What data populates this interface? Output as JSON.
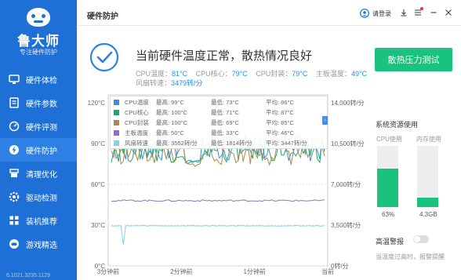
{
  "app": {
    "name": "鲁大师",
    "slogan": "专注硬件防护",
    "version": "6.1021.3235.1129"
  },
  "sidebar": {
    "items": [
      {
        "label": "硬件体检",
        "icon": "monitor-icon"
      },
      {
        "label": "硬件参数",
        "icon": "list-icon"
      },
      {
        "label": "硬件评测",
        "icon": "gauge-icon"
      },
      {
        "label": "硬件防护",
        "icon": "lightning-icon",
        "active": true
      },
      {
        "label": "清理优化",
        "icon": "broom-icon"
      },
      {
        "label": "驱动检测",
        "icon": "gear-icon"
      },
      {
        "label": "装机推荐",
        "icon": "grid-icon"
      },
      {
        "label": "游戏精选",
        "icon": "gamepad-icon"
      }
    ]
  },
  "header": {
    "title": "硬件防护",
    "login_label": "请登录"
  },
  "status": {
    "title": "当前硬件温度正常，散热情况良好",
    "cpu_temp_label": "CPU温度：",
    "cpu_temp_value": "81°C",
    "cpu_core_label": "CPU核心：",
    "cpu_core_value": "79°C",
    "cpu_pkg_label": "CPU封装：",
    "cpu_pkg_value": "79°C",
    "board_label": "主板温度：",
    "board_value": "49°C",
    "fan_label": "风扇转速：",
    "fan_value": "3479转/分"
  },
  "test_button": "散热压力测试",
  "chart_data": {
    "type": "line",
    "x": [
      "3分钟前",
      "2分钟前",
      "1分钟前",
      "当前"
    ],
    "y_left_ticks": [
      "0°C",
      "30°C",
      "60°C",
      "90°C",
      "120°C"
    ],
    "y_right_ticks": [
      "0转/分",
      "3,500转/分",
      "7,000转/分",
      "10,500转/分",
      "14,000转/分"
    ],
    "ylim_left": [
      0,
      120
    ],
    "ylim_right": [
      0,
      14000
    ],
    "series": [
      {
        "name": "CPU温度",
        "color": "#3b8fdc",
        "max": "最高: 99°C",
        "min": "最低: 73°C",
        "avg": "平均: 86°C",
        "level": 86,
        "amp": 9,
        "axis": "left"
      },
      {
        "name": "CPU核心",
        "color": "#1fa866",
        "max": "最高: 100°C",
        "min": "最低: 71°C",
        "avg": "平均: 87°C",
        "level": 86,
        "amp": 10,
        "axis": "left"
      },
      {
        "name": "CPU封装",
        "color": "#a88a4e",
        "max": "最高: 100°C",
        "min": "最低: 69°C",
        "avg": "平均: 85°C",
        "level": 84,
        "amp": 10,
        "axis": "left"
      },
      {
        "name": "主板温度",
        "color": "#8e6fd1",
        "max": "最高: 50°C",
        "min": "最低: 33°C",
        "avg": "平均: 46°C",
        "level": 48,
        "amp": 0.6,
        "axis": "left"
      },
      {
        "name": "风扇转速",
        "color": "#7fd3e8",
        "max": "最高: 3552转/分",
        "min": "最低: 1814转/分",
        "avg": "平均: 3447转/分",
        "level": 3440,
        "amp": 30,
        "axis": "right"
      }
    ]
  },
  "resources": {
    "title": "系统资源使用",
    "cpu_label": "CPU使用",
    "cpu_percent": 63,
    "cpu_value": "63%",
    "mem_label": "内存使用",
    "mem_percent": 16,
    "mem_value": "4.3GB"
  },
  "alarm": {
    "title": "高温警报",
    "desc": "当温度过高时，报警提醒"
  },
  "colors": {
    "sidebar": "#1e6fd6",
    "accent": "#19c37d",
    "value": "#1e90ff"
  }
}
